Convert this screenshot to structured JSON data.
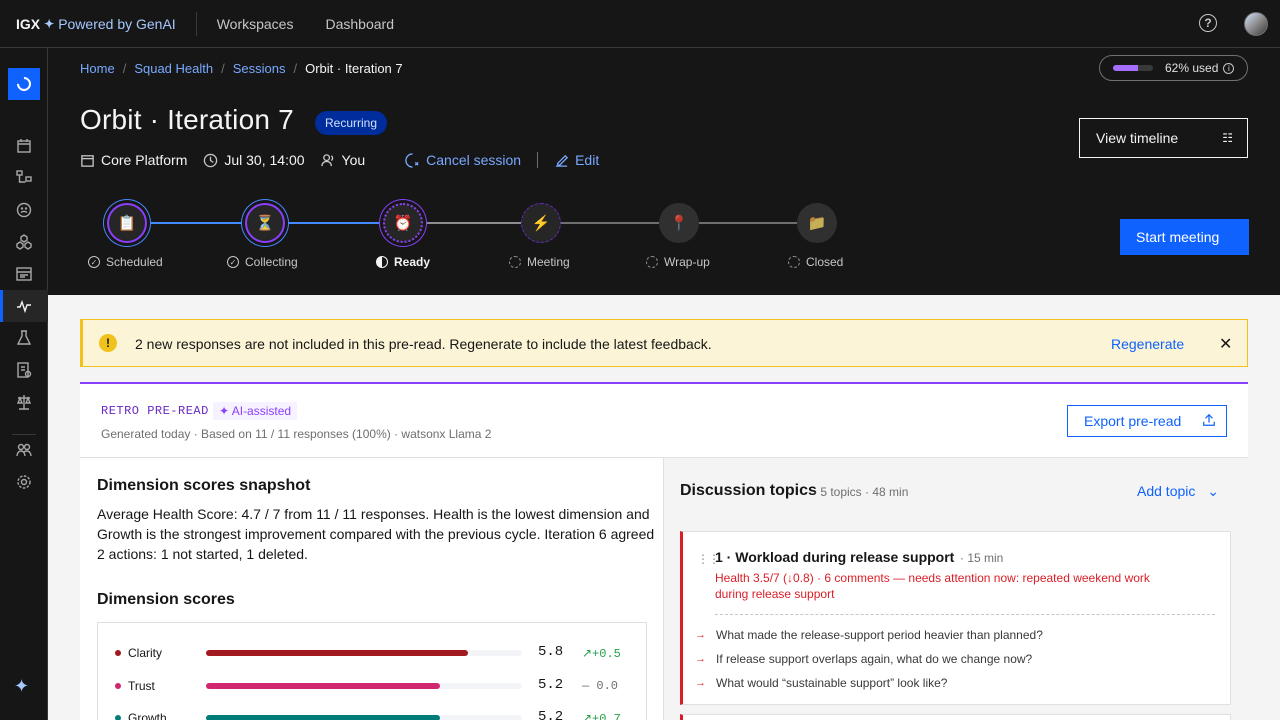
{
  "topbar": {
    "brand": "IGX",
    "brand_sub": "Powered by GenAI",
    "nav": [
      "Workspaces",
      "Dashboard"
    ],
    "help_icon": "help-icon",
    "help_glyph": "?"
  },
  "breadcrumb": {
    "items": [
      "Home",
      "Squad Health",
      "Sessions"
    ],
    "current": "Orbit · Iteration 7",
    "separator": "/"
  },
  "usage": {
    "label": "62% used",
    "percent": 62
  },
  "session": {
    "title": "Orbit · Iteration 7",
    "badge": "Recurring",
    "team": "Core Platform",
    "datetime": "Jul 30, 14:00",
    "owner": "You",
    "cancel_label": "Cancel session",
    "edit_label": "Edit"
  },
  "actions": {
    "timeline_label": "View timeline",
    "start_label": "Start meeting"
  },
  "stepper": {
    "steps": [
      {
        "label": "Scheduled",
        "state": "done",
        "icon": "📋"
      },
      {
        "label": "Collecting",
        "state": "done",
        "icon": "⏳"
      },
      {
        "label": "Ready",
        "state": "current",
        "icon": "⏰"
      },
      {
        "label": "Meeting",
        "state": "pending",
        "icon": "⚡"
      },
      {
        "label": "Wrap-up",
        "state": "pending",
        "icon": "📍"
      },
      {
        "label": "Closed",
        "state": "pending",
        "icon": "📁"
      }
    ]
  },
  "banner": {
    "text": "2 new responses are not included in this pre-read. Regenerate to include the latest feedback.",
    "action": "Regenerate",
    "glyph": "!",
    "close_glyph": "✕",
    "color": "#f1c21b"
  },
  "preread": {
    "kicker": "RETRO PRE-READ",
    "ai_tag": "✦ AI-assisted",
    "generated": "Generated today · Based on 11 / 11 responses (100%) · watsonx Llama 2",
    "export_label": "Export pre-read",
    "snapshot_title": "Dimension scores snapshot",
    "snapshot_text": "Average Health Score: 4.7 / 7 from 11 / 11 responses. Health is the lowest dimension and Growth is the strongest improvement compared with the previous cycle. Iteration 6 agreed 2 actions: 1 not started, 1 deleted.",
    "scores_title": "Dimension scores",
    "scores": [
      {
        "name": "Clarity",
        "value": "5.8",
        "delta": "↗+0.5",
        "fraction": 0.83,
        "color": "#a2191f",
        "delta_color": "#24a148"
      },
      {
        "name": "Trust",
        "value": "5.2",
        "delta": "— 0.0",
        "fraction": 0.74,
        "color": "#d02670",
        "delta_color": "#6f6f6f"
      },
      {
        "name": "Growth",
        "value": "5.2",
        "delta": "↗+0.7",
        "fraction": 0.74,
        "color": "#007d79",
        "delta_color": "#24a148"
      }
    ]
  },
  "topics": {
    "title": "Discussion topics",
    "meta": "· 5 topics · 48 min",
    "add_label": "Add topic",
    "items": [
      {
        "title": "1 · Workload during release support",
        "duration": "· 15 min",
        "warning": "Health 3.5/7 (↓0.8) · 6 comments — needs attention now: repeated weekend work during release support",
        "questions": [
          "What made the release-support period heavier than planned?",
          "If release support overlaps again, what do we change now?",
          "What would “sustainable support” look like?"
        ]
      }
    ]
  }
}
